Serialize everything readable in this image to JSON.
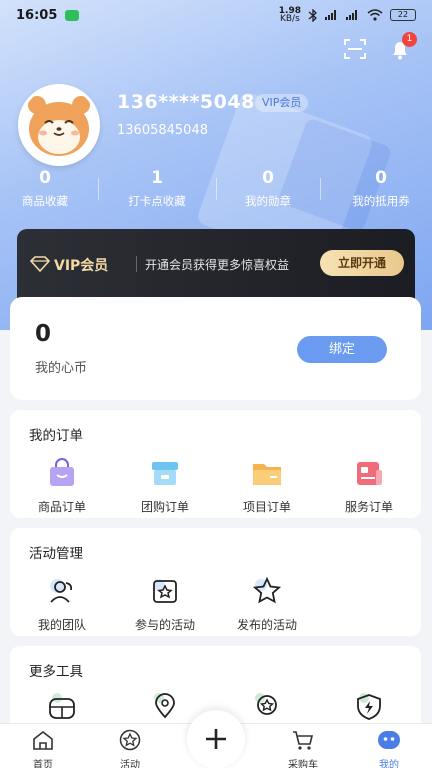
{
  "status_bar": {
    "time": "16:05",
    "net_speed_top": "1.98",
    "net_speed_bottom": "KB/s",
    "battery": "22"
  },
  "header": {
    "notification_count": "1"
  },
  "profile": {
    "masked_phone": "136****5048",
    "vip_tag": "VIP会员",
    "phone": "13605845048"
  },
  "stats": [
    {
      "value": "0",
      "label": "商品收藏"
    },
    {
      "value": "1",
      "label": "打卡点收藏"
    },
    {
      "value": "0",
      "label": "我的勋章"
    },
    {
      "value": "0",
      "label": "我的抵用券"
    }
  ],
  "vip_banner": {
    "title": "VIP会员",
    "desc": "开通会员获得更多惊喜权益",
    "button": "立即开通"
  },
  "coins": {
    "value": "0",
    "label": "我的心币",
    "button": "绑定"
  },
  "orders": {
    "title": "我的订单",
    "items": [
      {
        "label": "商品订单",
        "icon": "shopping-bag-icon"
      },
      {
        "label": "团购订单",
        "icon": "store-icon"
      },
      {
        "label": "项目订单",
        "icon": "folder-icon"
      },
      {
        "label": "服务订单",
        "icon": "service-card-icon"
      }
    ]
  },
  "activities": {
    "title": "活动管理",
    "items": [
      {
        "label": "我的团队",
        "icon": "team-icon"
      },
      {
        "label": "参与的活动",
        "icon": "star-frame-icon"
      },
      {
        "label": "发布的活动",
        "icon": "star-icon"
      }
    ]
  },
  "tools": {
    "title": "更多工具",
    "items": [
      {
        "icon": "tool-box-icon"
      },
      {
        "icon": "location-pin-icon"
      },
      {
        "icon": "medal-icon"
      },
      {
        "icon": "shield-bolt-icon"
      }
    ]
  },
  "tabbar": {
    "items": [
      {
        "label": "首页",
        "icon": "home-icon"
      },
      {
        "label": "活动",
        "icon": "activity-star-icon"
      },
      {
        "label": "采购车",
        "icon": "cart-icon"
      },
      {
        "label": "我的",
        "icon": "profile-icon",
        "active": true
      }
    ]
  },
  "colors": {
    "accent": "#4a7ee6",
    "vip_gold": "#f3d9a4",
    "badge": "#f0443c"
  }
}
